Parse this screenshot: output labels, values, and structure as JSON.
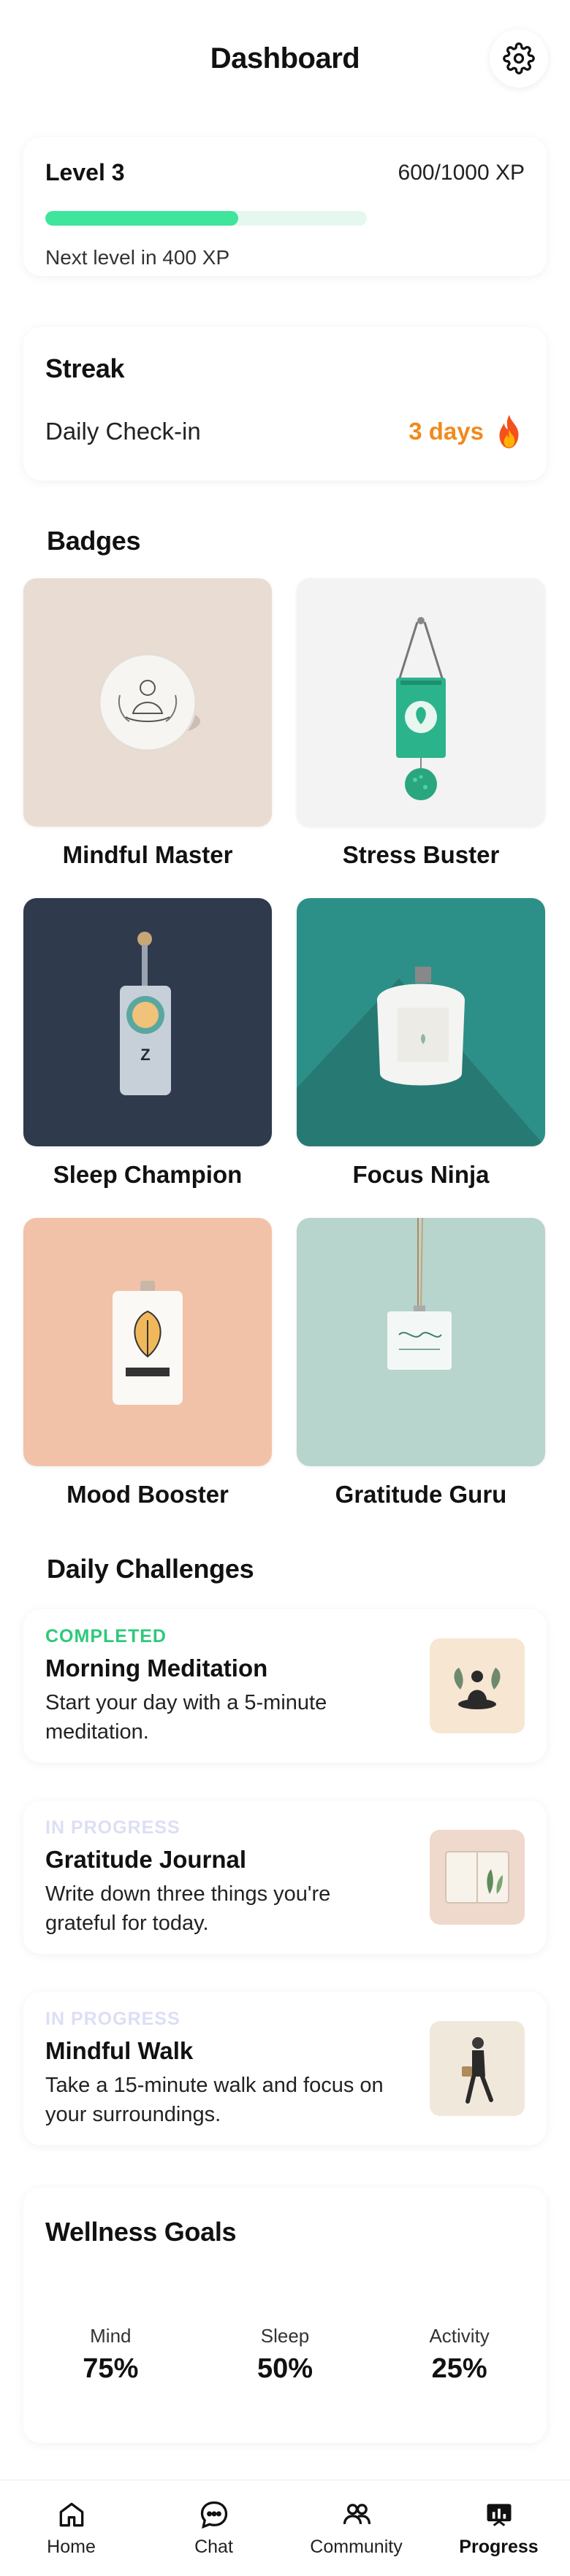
{
  "header": {
    "title": "Dashboard"
  },
  "level": {
    "label": "Level 3",
    "xp_text": "600/1000 XP",
    "progress_fraction": 0.6,
    "next_level_text": "Next level in 400 XP"
  },
  "streak": {
    "title": "Streak",
    "checkin_label": "Daily Check-in",
    "days_text": "3 days"
  },
  "badges": {
    "title": "Badges",
    "items": [
      {
        "label": "Mindful Master"
      },
      {
        "label": "Stress Buster"
      },
      {
        "label": "Sleep Champion"
      },
      {
        "label": "Focus Ninja"
      },
      {
        "label": "Mood Booster"
      },
      {
        "label": "Gratitude Guru"
      }
    ]
  },
  "challenges": {
    "title": "Daily Challenges",
    "items": [
      {
        "status": "COMPLETED",
        "name": "Morning Meditation",
        "desc": "Start your day with a 5-minute meditation."
      },
      {
        "status": "IN PROGRESS",
        "name": "Gratitude Journal",
        "desc": "Write down three things you're grateful for today."
      },
      {
        "status": "IN PROGRESS",
        "name": "Mindful Walk",
        "desc": "Take a 15-minute walk and focus on your surroundings."
      }
    ]
  },
  "goals": {
    "title": "Wellness Goals",
    "items": [
      {
        "label": "Mind",
        "value": "75%"
      },
      {
        "label": "Sleep",
        "value": "50%"
      },
      {
        "label": "Activity",
        "value": "25%"
      }
    ]
  },
  "nav": {
    "items": [
      {
        "label": "Home",
        "icon": "home-icon"
      },
      {
        "label": "Chat",
        "icon": "chat-icon"
      },
      {
        "label": "Community",
        "icon": "community-icon"
      },
      {
        "label": "Progress",
        "icon": "progress-icon"
      }
    ],
    "active": "Progress"
  },
  "colors": {
    "accent_green": "#3ee59a",
    "streak_orange": "#f08a1d",
    "completed_green": "#2ec97a",
    "in_progress_lavender": "#dcdff4"
  }
}
